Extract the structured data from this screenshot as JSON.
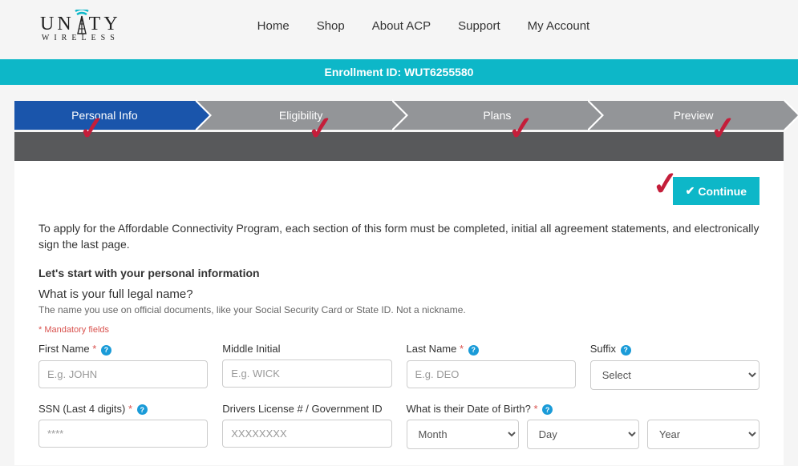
{
  "header": {
    "logo_main": "UN  TY",
    "logo_sub": "WIRELESS",
    "nav": [
      "Home",
      "Shop",
      "About ACP",
      "Support",
      "My Account"
    ]
  },
  "enrollment_bar": "Enrollment ID: WUT6255580",
  "steps": [
    {
      "label": "Personal Info",
      "active": true
    },
    {
      "label": "Eligibility",
      "active": false
    },
    {
      "label": "Plans",
      "active": false
    },
    {
      "label": "Preview",
      "active": false
    }
  ],
  "continue_label": "Continue",
  "intro_text": "To apply for the Affordable Connectivity Program, each section of this form must be completed, initial all agreement statements, and electronically sign the last page.",
  "section_title": "Let's start with your personal information",
  "question": "What is your full legal name?",
  "question_hint": "The name you use on official documents, like your Social Security Card or State ID. Not a nickname.",
  "mandatory_note": "* Mandatory fields",
  "fields": {
    "first_name": {
      "label": "First Name",
      "placeholder": "E.g. JOHN",
      "required": true,
      "help": true
    },
    "middle_initial": {
      "label": "Middle Initial",
      "placeholder": "E.g. WICK",
      "required": false,
      "help": false
    },
    "last_name": {
      "label": "Last Name",
      "placeholder": "E.g. DEO",
      "required": true,
      "help": true
    },
    "suffix": {
      "label": "Suffix",
      "placeholder": "Select",
      "required": false,
      "help": true
    },
    "ssn": {
      "label": "SSN (Last 4 digits)",
      "placeholder": "****",
      "required": true,
      "help": true
    },
    "dl": {
      "label": "Drivers License # / Government ID",
      "placeholder": "XXXXXXXX",
      "required": false,
      "help": false
    },
    "dob": {
      "label": "What is their Date of Birth?",
      "required": true,
      "help": true,
      "month": "Month",
      "day": "Day",
      "year": "Year"
    }
  }
}
